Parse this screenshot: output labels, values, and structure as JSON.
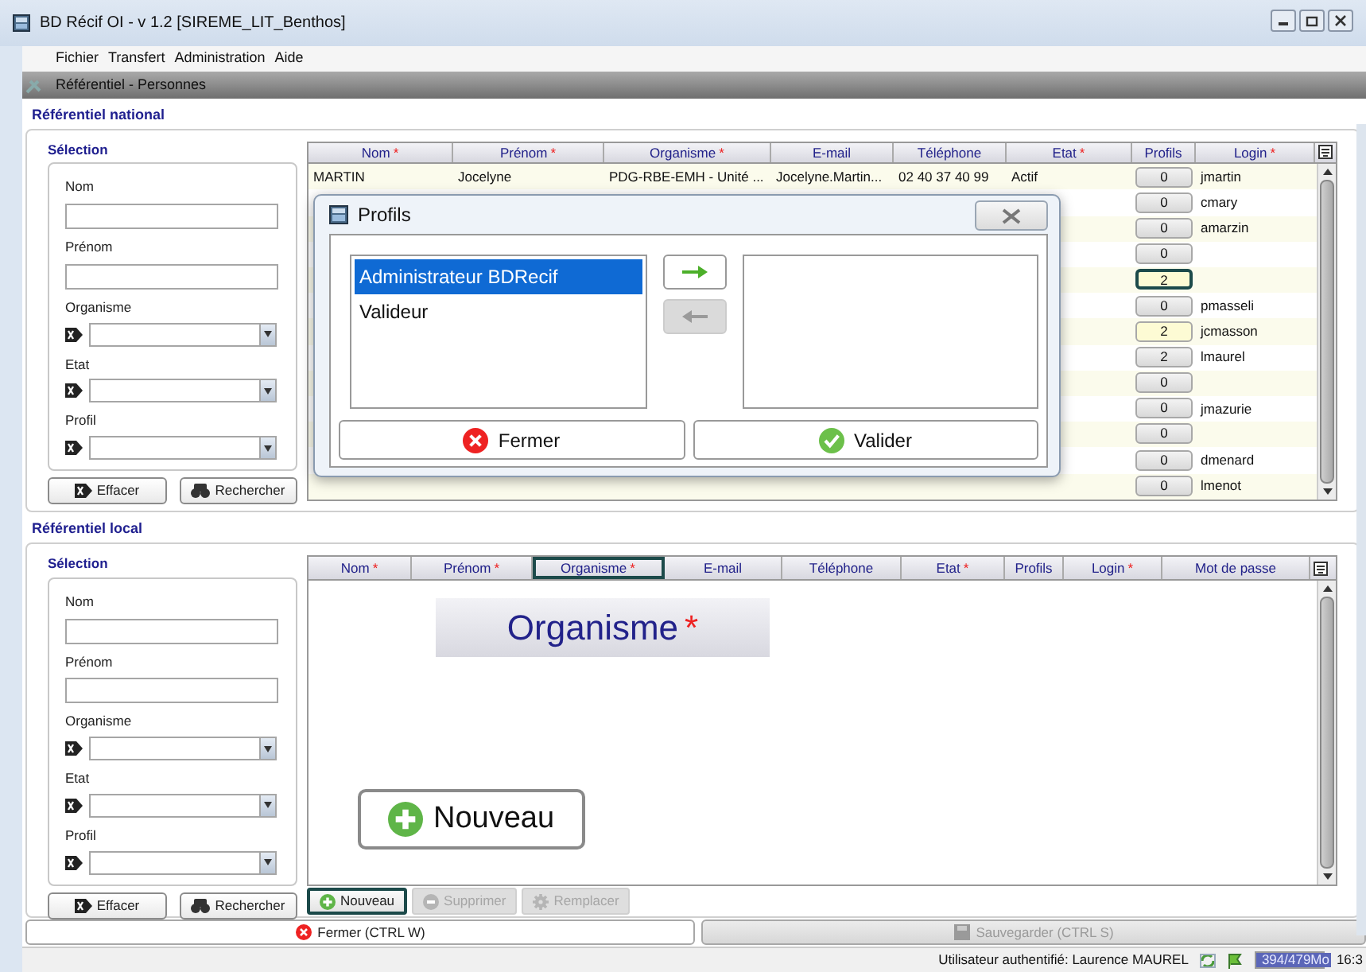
{
  "window": {
    "title": "BD Récif OI - v 1.2 [SIREME_LIT_Benthos]"
  },
  "menu": [
    {
      "label": "Fichier"
    },
    {
      "label": "Transfert"
    },
    {
      "label": "Administration"
    },
    {
      "label": "Aide"
    }
  ],
  "frame": {
    "title": "Référentiel - Personnes"
  },
  "national": {
    "title": "Référentiel national",
    "selection": {
      "title": "Sélection",
      "fields": [
        {
          "label": "Nom",
          "kind": "text"
        },
        {
          "label": "Prénom",
          "kind": "text"
        },
        {
          "label": "Organisme",
          "kind": "combo"
        },
        {
          "label": "Etat",
          "kind": "combo"
        },
        {
          "label": "Profil",
          "kind": "combo"
        }
      ],
      "buttons": [
        {
          "label": "Effacer",
          "kind": "clear"
        },
        {
          "label": "Rechercher",
          "kind": "search"
        }
      ]
    },
    "table": {
      "columns": [
        {
          "label": "Nom",
          "required_mark": "*",
          "selected": false
        },
        {
          "label": "Prénom",
          "required_mark": "*",
          "selected": false
        },
        {
          "label": "Organisme",
          "required_mark": "*",
          "selected": false
        },
        {
          "label": "E-mail",
          "selected": false
        },
        {
          "label": "Téléphone",
          "selected": false
        },
        {
          "label": "Etat",
          "required_mark": "*",
          "selected": false
        },
        {
          "label": "Profils",
          "selected": false
        },
        {
          "label": "Login",
          "required_mark": "*",
          "selected": false
        }
      ],
      "rows": [
        {
          "nom": "MARTIN",
          "prenom": "Jocelyne",
          "organisme": "PDG-RBE-EMH - Unité ...",
          "email": "Jocelyne.Martin...",
          "telephone": "02 40 37 40 99",
          "etat": "Actif",
          "profils": "0",
          "login": "jmartin",
          "selected": false,
          "modified": false
        },
        {
          "profils": "0",
          "login": "cmary",
          "selected": false,
          "modified": false
        },
        {
          "profils": "0",
          "login": "amarzin",
          "selected": false,
          "modified": false
        },
        {
          "profils": "0",
          "selected": false,
          "modified": false
        },
        {
          "profils": "2",
          "selected": true,
          "modified": true
        },
        {
          "profils": "0",
          "login": "pmasseli",
          "selected": false,
          "modified": false
        },
        {
          "profils": "2",
          "login": "jcmasson",
          "selected": false,
          "modified": true
        },
        {
          "profils": "2",
          "login": "lmaurel",
          "selected": false,
          "modified": false
        },
        {
          "profils": "0",
          "selected": false,
          "modified": false
        },
        {
          "profils": "0",
          "login": "jmazurie",
          "selected": false,
          "modified": false
        },
        {
          "profils": "0",
          "selected": false,
          "modified": false
        },
        {
          "profils": "0",
          "login": "dmenard",
          "selected": false,
          "modified": false
        },
        {
          "profils": "0",
          "login": "lmenot",
          "selected": false,
          "modified": false
        }
      ]
    },
    "dialog": {
      "title": "Profils",
      "available": [
        {
          "label": "Administrateur BDRecif",
          "selected": true
        },
        {
          "label": "Valideur",
          "selected": false
        }
      ],
      "move_buttons": [
        {
          "kind": "add",
          "disabled": false
        },
        {
          "kind": "remove",
          "disabled": true
        }
      ],
      "buttons": [
        {
          "label": "Fermer",
          "kind": "close"
        },
        {
          "label": "Valider",
          "kind": "validate"
        }
      ]
    }
  },
  "local": {
    "title": "Référentiel local",
    "selection": {
      "title": "Sélection",
      "fields": [
        {
          "label": "Nom",
          "kind": "text"
        },
        {
          "label": "Prénom",
          "kind": "text"
        },
        {
          "label": "Organisme",
          "kind": "combo"
        },
        {
          "label": "Etat",
          "kind": "combo"
        },
        {
          "label": "Profil",
          "kind": "combo"
        }
      ],
      "buttons": [
        {
          "label": "Effacer",
          "kind": "clear"
        },
        {
          "label": "Rechercher",
          "kind": "search"
        }
      ]
    },
    "table": {
      "columns": [
        {
          "label": "Nom",
          "required_mark": "*",
          "selected": false
        },
        {
          "label": "Prénom",
          "required_mark": "*",
          "selected": false
        },
        {
          "label": "Organisme",
          "required_mark": "*",
          "selected": true
        },
        {
          "label": "E-mail",
          "selected": false
        },
        {
          "label": "Téléphone",
          "selected": false
        },
        {
          "label": "Etat",
          "required_mark": "*",
          "selected": false
        },
        {
          "label": "Profils",
          "selected": false
        },
        {
          "label": "Login",
          "required_mark": "*",
          "selected": false
        },
        {
          "label": "Mot de passe",
          "selected": false
        }
      ]
    },
    "actions": [
      {
        "label": "Nouveau",
        "kind": "add",
        "disabled": false,
        "selected": true
      },
      {
        "label": "Supprimer",
        "kind": "delete",
        "disabled": true,
        "selected": false
      },
      {
        "label": "Remplacer",
        "kind": "replace",
        "disabled": true,
        "selected": false
      }
    ],
    "callouts": [
      {
        "kind": "header",
        "label": "Organisme",
        "required_mark": "*"
      },
      {
        "kind": "button",
        "label": "Nouveau"
      }
    ]
  },
  "bottom_buttons": [
    {
      "label": "Fermer (CTRL W)",
      "kind": "close",
      "disabled": false
    },
    {
      "label": "Sauvegarder (CTRL S)",
      "kind": "save",
      "disabled": true
    }
  ],
  "status_bar": {
    "user": "Utilisateur authentifié: Laurence MAUREL",
    "memory": "394/479Mo",
    "level": 0.82,
    "time": "16:3"
  }
}
